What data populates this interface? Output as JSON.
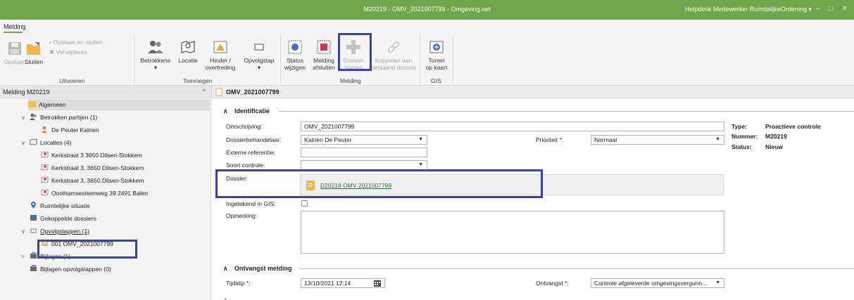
{
  "window": {
    "title": "M20219 - OMV_2021007799 - Omgeving.net",
    "user": "Helpdesk Medewerker RuimtelijkeOrdening",
    "user_caret": "▾",
    "controls": "– □ ✕"
  },
  "ribbon": {
    "tab": "Melding",
    "uitvoeren": {
      "opslaan": "Opslaan",
      "sluiten": "Sluiten",
      "opslaan_sluiten": "Opslaan en sluiten",
      "verwijderen": "Verwijderen",
      "group": "Uitvoeren"
    },
    "toevoegen": {
      "betrokkene": "Betrokkene",
      "locatie": "Locatie",
      "hinder_line1": "Hinder /",
      "hinder_line2": "overtreding",
      "opvolgstap": "Opvolgstap",
      "group": "Toevoegen",
      "caret": "▾"
    },
    "melding": {
      "status_line1": "Status",
      "status_line2": "wijzigen",
      "afsluiten_line1": "Melding",
      "afsluiten_line2": "afsluiten",
      "dossier_line1": "Dossier",
      "dossier_line2": "starten",
      "koppelen_line1": "Koppelen aan",
      "koppelen_line2": "bestaand dossier",
      "group": "Melding"
    },
    "gis": {
      "tonen_line1": "Tonen",
      "tonen_line2": "op kaart",
      "group": "GIS"
    }
  },
  "left_panel": {
    "header": "Melding M20219",
    "collapse": "^",
    "tree": {
      "algemeen": "Algemeen",
      "betrokken": "Betrokken partijen (1)",
      "betrokken_child": "De Peuter Katrien",
      "locaties": "Locaties (4)",
      "locatie_1": "Kerkstraat 3 3650 Dilsen-Stokkem",
      "locatie_2": "Kerkstraat 3, 3650 Dilsen-Stokkem",
      "locatie_3": "Kerkstraat 3, 3650 Dilsen-Stokkem",
      "locatie_4": "Oosthamsesteenweg 39 2491 Balen",
      "ruimtelijke": "Ruimtelijke situatie",
      "gekoppelde": "Gekoppelde dossiers",
      "opvolgstappen": "Opvolgstappen (1)",
      "opvolgstap_child": "001 OMV_2021007799",
      "bijlagen": "Bijlagen (1)",
      "bijlagen_opvolg": "Bijlagen opvolgstappen (0)",
      "exp_open": "∨",
      "exp_closed": ">"
    }
  },
  "main": {
    "header": "OMV_2021007799",
    "identificatie": {
      "section": "Identificatie",
      "omschrijving_label": "Omschrijving:",
      "omschrijving_value": "OMV_2021007799",
      "behandelaar_label": "Dossierbehandelaar:",
      "behandelaar_value": "Katrien De Peuter",
      "prioriteit_label": "Prioriteit *:",
      "prioriteit_value": "Normaal",
      "externe_label": "Externe referentie:",
      "externe_value": "",
      "soort_label": "Soort controle:",
      "soort_value": "",
      "dossier_label": "Dossier:",
      "dossier_link": "D20218 OMV 2021007799",
      "gis_label": "Ingetekend in GIS:",
      "opmerking_label": "Opmerking:",
      "caret": "▼"
    },
    "meta": {
      "type_label": "Type:",
      "type_value": "Proactieve controle",
      "nummer_label": "Nummer:",
      "nummer_value": "M20219",
      "status_label": "Status:",
      "status_value": "Nieuw"
    },
    "ontvangst": {
      "section": "Ontvangst melding",
      "tijdstip_label": "Tijdstip *:",
      "tijdstip_value": "13/10/2021 12:14",
      "ontvangst_label": "Ontvangst *:",
      "ontvangst_value": "Controle afgeleverde omgevingsvergunn...",
      "caret": "▼"
    },
    "collapse_glyph": "∧"
  },
  "colors": {
    "titlebar": "#6fa64a",
    "highlight": "#3a3fb8",
    "link": "#2e6f2a"
  }
}
